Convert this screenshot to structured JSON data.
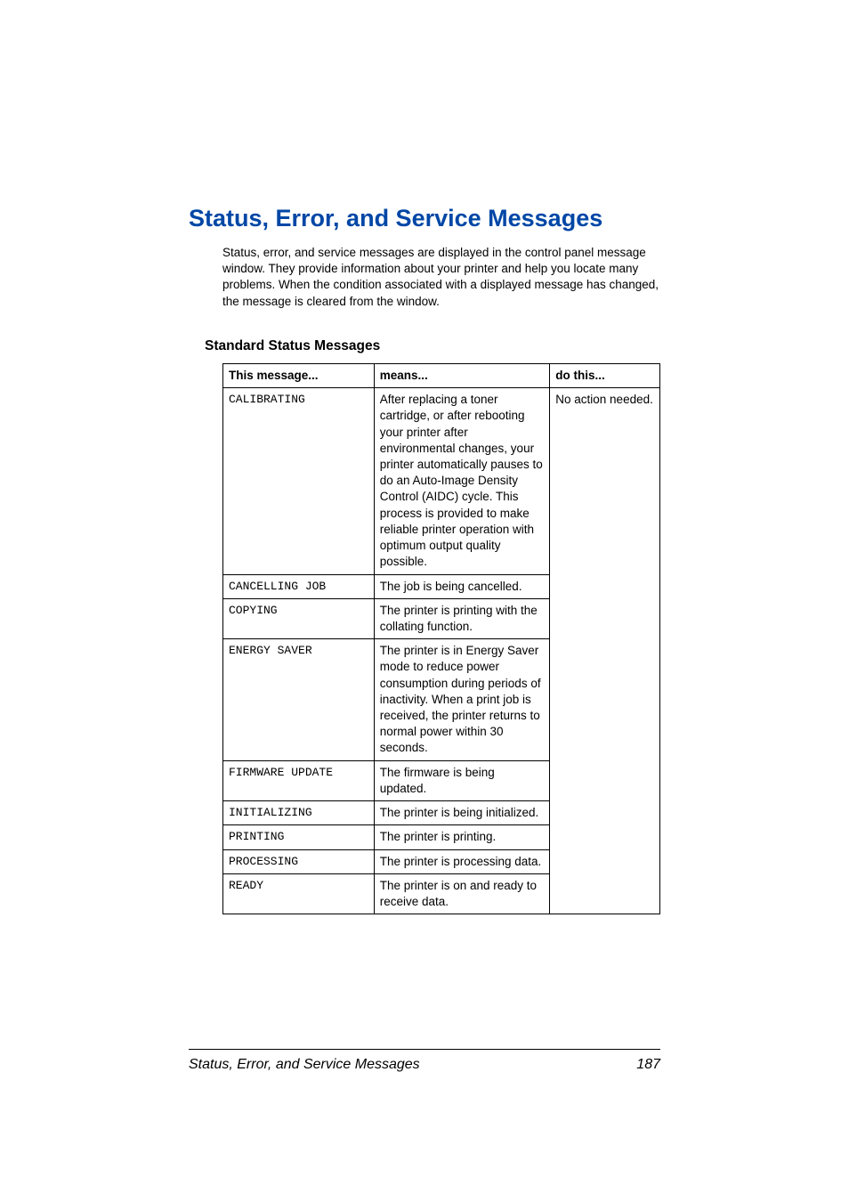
{
  "title": "Status, Error, and Service Messages",
  "intro": "Status, error, and service messages are displayed in the control panel message window. They provide information about your printer and help you locate many problems. When the condition associated with a displayed message has changed, the message is cleared from the window.",
  "sectionHeading": "Standard Status Messages",
  "table": {
    "headers": [
      "This message...",
      "means...",
      "do this..."
    ],
    "action": "No action needed.",
    "rows": [
      {
        "msg": "CALIBRATING",
        "means": "After replacing a toner cartridge, or after rebooting your printer after environmental changes, your printer automatically pauses to do an Auto-Image Density Control (AIDC) cycle. This process is provided to make reliable printer operation with optimum output quality possible."
      },
      {
        "msg": "CANCELLING JOB",
        "means": "The job is being cancelled."
      },
      {
        "msg": "COPYING",
        "means": "The printer is printing with the collating function."
      },
      {
        "msg": "ENERGY SAVER",
        "means": "The printer is in Energy Saver mode to reduce power consumption during periods of inactivity. When a print job is received, the printer returns to normal power within 30 seconds."
      },
      {
        "msg": "FIRMWARE UPDATE",
        "means": "The firmware is being updated."
      },
      {
        "msg": "INITIALIZING",
        "means": "The printer is being initialized."
      },
      {
        "msg": "PRINTING",
        "means": "The printer is printing."
      },
      {
        "msg": "PROCESSING",
        "means": "The printer is processing data."
      },
      {
        "msg": "READY",
        "means": "The printer is on and ready to receive data."
      }
    ]
  },
  "footer": {
    "text": "Status, Error, and Service Messages",
    "page": "187"
  }
}
